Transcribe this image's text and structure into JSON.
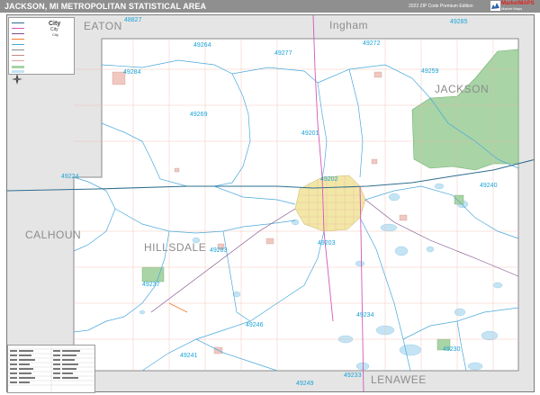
{
  "header": {
    "title": "JACKSON, MI METROPOLITAN STATISTICAL AREA",
    "edition": "2022 ZIP Code Premium Edition",
    "brand": "MarketMAPS",
    "brand_sub": "Market Maps"
  },
  "counties": [
    {
      "id": "eaton",
      "label": "EATON"
    },
    {
      "id": "ingham",
      "label": "Ingham"
    },
    {
      "id": "jackson",
      "label": "JACKSON"
    },
    {
      "id": "calhoun",
      "label": "CALHOUN"
    },
    {
      "id": "hillsdale",
      "label": "HILLSDALE"
    },
    {
      "id": "lenawee",
      "label": "LENAWEE"
    }
  ],
  "zip_labels": [
    "48827",
    "49285",
    "49272",
    "49264",
    "49277",
    "49259",
    "49284",
    "49269",
    "49201",
    "49224",
    "49202",
    "49240",
    "49203",
    "49283",
    "49237",
    "49234",
    "49246",
    "49241",
    "49230",
    "49233",
    "49249"
  ],
  "legend": {
    "city_sample": [
      "City",
      "City",
      "City"
    ]
  },
  "colors": {
    "header_bg": "#8f8f8f",
    "zip_label": "#1aa3d6",
    "zip_boundary": "#4aa8dc",
    "county_label": "#8d8d8d",
    "county_shade": "#e5e5e5",
    "state_forest": "#a8d4a6",
    "water": "#c4e4f4",
    "urban": "#f2e7a6",
    "highway_major": "#2e6e8e",
    "highway_us": "#d257b8",
    "roads_local": "#f0b9a8"
  },
  "icons": [
    "north-arrow-icon",
    "brand-logo-icon"
  ]
}
